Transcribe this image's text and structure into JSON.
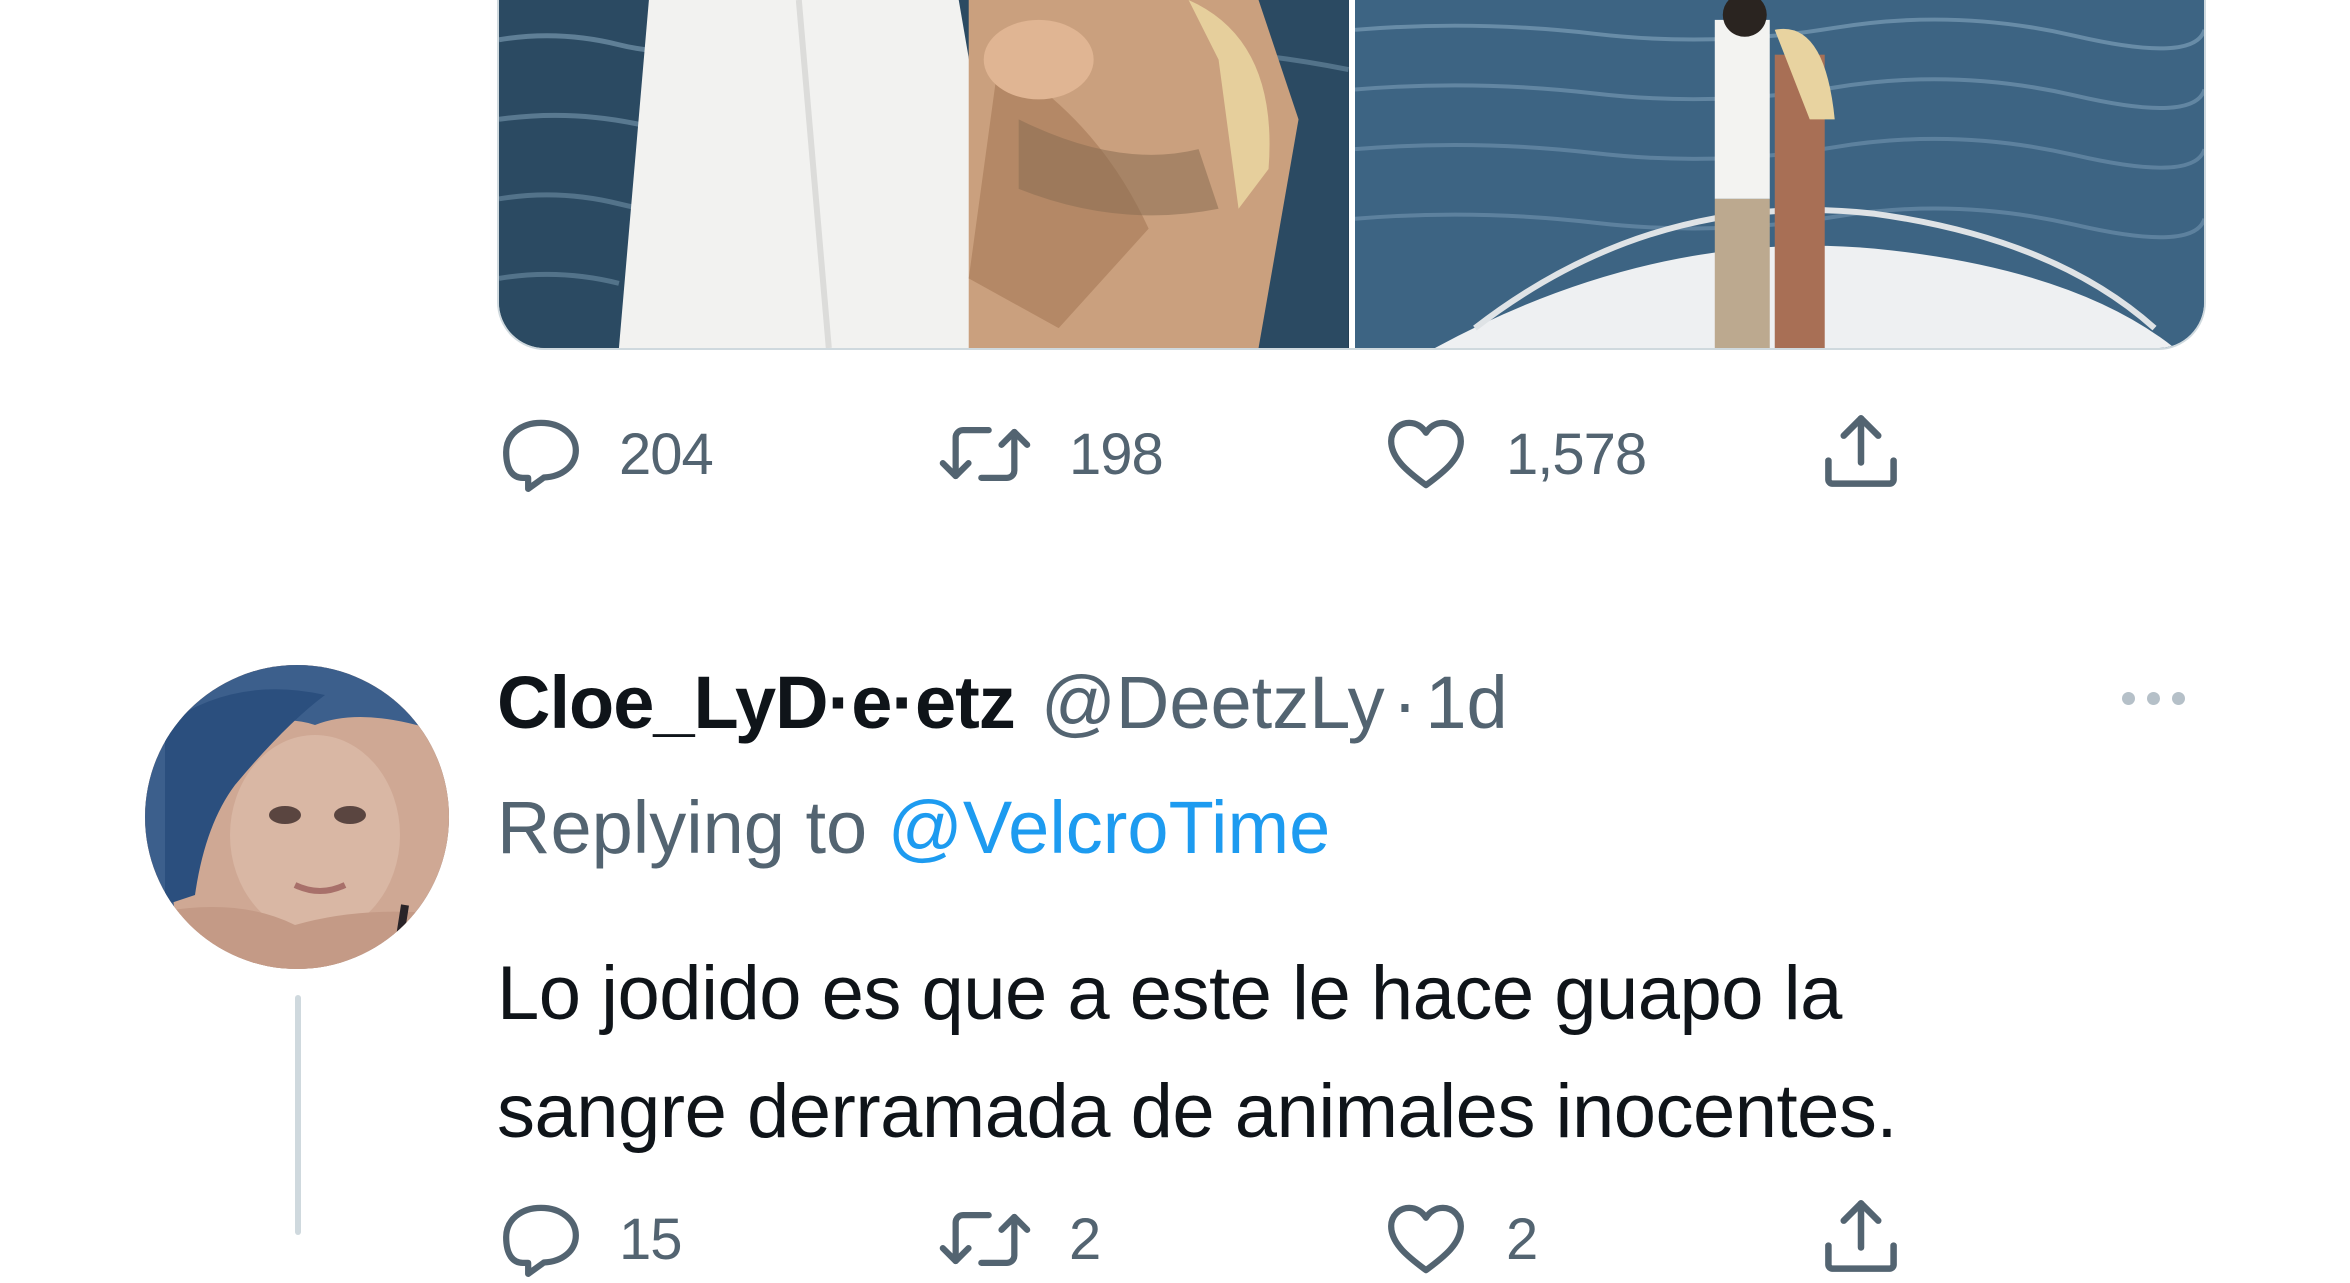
{
  "tweet": {
    "media": {
      "image_left": "Couple embracing on a boat over blue water, close-up",
      "image_right": "Couple kissing on the bow of a white boat at sea"
    },
    "actions": {
      "reply_count": "204",
      "retweet_count": "198",
      "like_count": "1,578"
    }
  },
  "reply": {
    "display_name": "Cloe_LyD·e·etz",
    "handle": "@DeetzLy",
    "separator": "·",
    "time": "1d",
    "replying_prefix": "Replying to",
    "replying_to": "@VelcroTime",
    "text_line1": "Lo jodido es que a este le hace guapo la",
    "text_line2": "sangre derramada de animales inocentes.",
    "actions": {
      "reply_count": "15",
      "retweet_count": "2",
      "like_count": "2"
    }
  },
  "icons": [
    "reply-icon",
    "retweet-icon",
    "like-icon",
    "share-icon",
    "more-icon"
  ],
  "colors": {
    "text": "#0f1419",
    "secondary": "#536471",
    "link": "#1d9bf0",
    "border": "#cfd9de"
  }
}
